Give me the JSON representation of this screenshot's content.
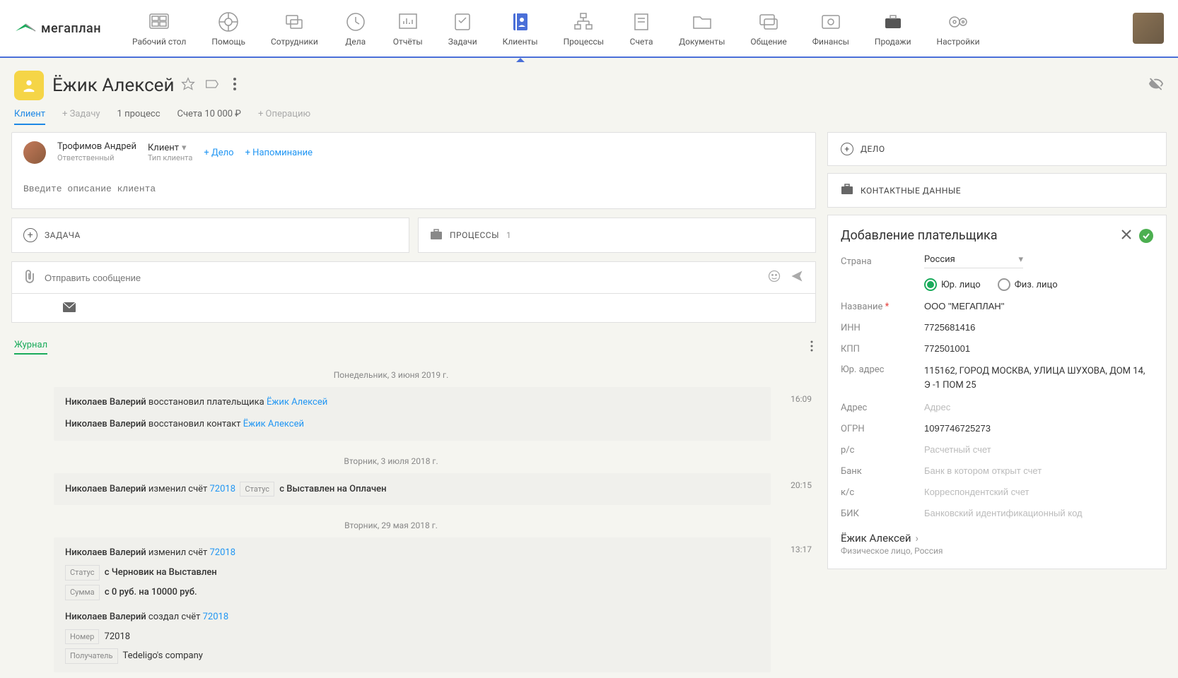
{
  "logo_text": "мегаплан",
  "nav": [
    {
      "label": "Рабочий стол"
    },
    {
      "label": "Помощь"
    },
    {
      "label": "Сотрудники"
    },
    {
      "label": "Дела"
    },
    {
      "label": "Отчёты"
    },
    {
      "label": "Задачи"
    },
    {
      "label": "Клиенты"
    },
    {
      "label": "Процессы"
    },
    {
      "label": "Счета"
    },
    {
      "label": "Документы"
    },
    {
      "label": "Общение"
    },
    {
      "label": "Финансы"
    },
    {
      "label": "Продажи"
    },
    {
      "label": "Настройки"
    }
  ],
  "client_name": "Ёжик Алексей",
  "tabs": {
    "client": "Клиент",
    "add_task": "+ Задачу",
    "processes": "1 процесс",
    "invoices": "Счета 10 000 ₽",
    "add_operation": "+ Операцию"
  },
  "responsible": {
    "name": "Трофимов Андрей",
    "role": "Ответственный",
    "type_value": "Клиент",
    "type_label": "Тип клиента",
    "add_case": "+ Дело",
    "add_reminder": "+ Напоминание"
  },
  "desc_placeholder": "Введите описание клиента",
  "task_btn": "ЗАДАЧА",
  "processes_btn": "ПРОЦЕССЫ",
  "processes_count": "1",
  "msg_placeholder": "Отправить сообщение",
  "journal_label": "Журнал",
  "journal": {
    "date1": "Понедельник, 3 июня 2019 г.",
    "entry1_time": "16:09",
    "entry1_name": "Николаев Валерий",
    "entry1_action1": " восстановил плательщика ",
    "entry1_link1": "Ёжик Алексей",
    "entry1_action2": " восстановил контакт ",
    "entry1_link2": "Ёжик Алексей",
    "date2": "Вторник, 3 июля 2018 г.",
    "entry2_time": "20:15",
    "entry2_name": "Николаев Валерий",
    "entry2_action": " изменил счёт ",
    "entry2_link": "72018",
    "entry2_status_label": "Статус",
    "entry2_status_text": "с Выставлен на Оплачен",
    "date3": "Вторник, 29 мая 2018 г.",
    "entry3_time": "13:17",
    "entry3a_name": "Николаев Валерий",
    "entry3a_action": " изменил счёт ",
    "entry3a_link": "72018",
    "entry3a_status_label": "Статус",
    "entry3a_status_text": "с Черновик на Выставлен",
    "entry3a_sum_label": "Сумма",
    "entry3a_sum_text": "с 0 руб. на 10000 руб.",
    "entry3b_name": "Николаев Валерий",
    "entry3b_action": " создал счёт ",
    "entry3b_link": "72018",
    "entry3b_num_label": "Номер",
    "entry3b_num_text": "72018",
    "entry3b_rec_label": "Получатель",
    "entry3b_rec_text": "Tedeligo's company"
  },
  "side": {
    "case": "ДЕЛО",
    "contacts": "КОНТАКТНЫЕ ДАННЫЕ"
  },
  "payer": {
    "title": "Добавление плательщика",
    "country_label": "Страна",
    "country_value": "Россия",
    "legal": "Юр. лицо",
    "individual": "Физ. лицо",
    "name_label": "Название",
    "name_value": "ООО \"МЕГАПЛАН\"",
    "inn_label": "ИНН",
    "inn_value": "7725681416",
    "kpp_label": "КПП",
    "kpp_value": "772501001",
    "legal_addr_label": "Юр. адрес",
    "legal_addr_value": "115162, ГОРОД МОСКВА, УЛИЦА ШУХОВА, ДОМ 14, Э -1 ПОМ 25",
    "addr_label": "Адрес",
    "addr_placeholder": "Адрес",
    "ogrn_label": "ОГРН",
    "ogrn_value": "1097746725273",
    "rs_label": "р/с",
    "rs_placeholder": "Расчетный счет",
    "bank_label": "Банк",
    "bank_placeholder": "Банк в котором открыт счет",
    "ks_label": "к/с",
    "ks_placeholder": "Корреспондентский счет",
    "bik_label": "БИК",
    "bik_placeholder": "Банковский идентификационный код",
    "bottom_link": "Ёжик Алексей",
    "bottom_sub": "Физическое лицо, Россия"
  }
}
